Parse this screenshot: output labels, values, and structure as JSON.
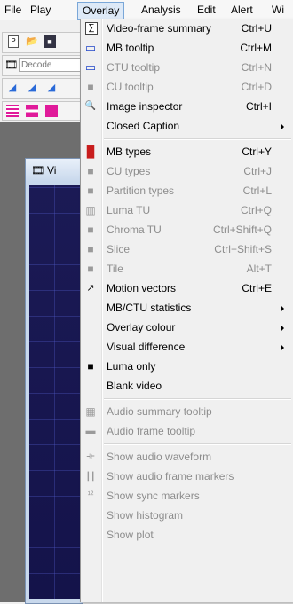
{
  "menubar": {
    "items": [
      "File",
      "Play",
      "Overlay",
      "Analysis",
      "Edit",
      "Alert",
      "Wi"
    ],
    "active": "Overlay"
  },
  "toolbar": {
    "decode_label": "Decode"
  },
  "child_window": {
    "title": "Vi"
  },
  "overlay_menu": {
    "groups": [
      [
        {
          "label": "Video-frame summary",
          "shortcut": "Ctrl+U",
          "icon": "summary-icon",
          "enabled": true
        },
        {
          "label": "MB tooltip",
          "shortcut": "Ctrl+M",
          "icon": "tooltip-icon",
          "enabled": true
        },
        {
          "label": "CTU tooltip",
          "shortcut": "Ctrl+N",
          "icon": "tooltip-icon",
          "enabled": false
        },
        {
          "label": "CU tooltip",
          "shortcut": "Ctrl+D",
          "icon": "square-icon",
          "enabled": false
        },
        {
          "label": "Image inspector",
          "shortcut": "Ctrl+I",
          "icon": "magnifier-icon",
          "enabled": true
        },
        {
          "label": "Closed Caption",
          "shortcut": "",
          "submenu": true,
          "enabled": true
        }
      ],
      [
        {
          "label": "MB types",
          "shortcut": "Ctrl+Y",
          "icon": "grid-icon",
          "enabled": true
        },
        {
          "label": "CU types",
          "shortcut": "Ctrl+J",
          "icon": "square-icon",
          "enabled": false
        },
        {
          "label": "Partition types",
          "shortcut": "Ctrl+L",
          "icon": "square-icon",
          "enabled": false
        },
        {
          "label": "Luma TU",
          "shortcut": "Ctrl+Q",
          "icon": "luma-tu-icon",
          "enabled": false
        },
        {
          "label": "Chroma TU",
          "shortcut": "Ctrl+Shift+Q",
          "icon": "square-icon",
          "enabled": false
        },
        {
          "label": "Slice",
          "shortcut": "Ctrl+Shift+S",
          "icon": "square-icon",
          "enabled": false
        },
        {
          "label": "Tile",
          "shortcut": "Alt+T",
          "icon": "square-icon",
          "enabled": false
        },
        {
          "label": "Motion vectors",
          "shortcut": "Ctrl+E",
          "icon": "arrow-icon",
          "enabled": true
        },
        {
          "label": "MB/CTU statistics",
          "shortcut": "",
          "submenu": true,
          "enabled": true
        },
        {
          "label": "Overlay colour",
          "shortcut": "",
          "submenu": true,
          "enabled": true
        },
        {
          "label": "Visual difference",
          "shortcut": "",
          "submenu": true,
          "enabled": true
        },
        {
          "label": "Luma only",
          "shortcut": "",
          "icon": "luma-only-icon",
          "enabled": true
        },
        {
          "label": "Blank video",
          "shortcut": "",
          "enabled": true
        }
      ],
      [
        {
          "label": "Audio summary tooltip",
          "shortcut": "",
          "icon": "audio-summary-icon",
          "enabled": false
        },
        {
          "label": "Audio frame tooltip",
          "shortcut": "",
          "icon": "audio-frame-icon",
          "enabled": false
        }
      ],
      [
        {
          "label": "Show audio waveform",
          "shortcut": "",
          "icon": "waveform-icon",
          "enabled": false
        },
        {
          "label": "Show audio frame markers",
          "shortcut": "",
          "icon": "frame-markers-icon",
          "enabled": false
        },
        {
          "label": "Show sync markers",
          "shortcut": "",
          "icon": "sync-markers-icon",
          "enabled": false
        },
        {
          "label": "Show histogram",
          "shortcut": "",
          "enabled": false
        },
        {
          "label": "Show plot",
          "shortcut": "",
          "enabled": false
        }
      ]
    ]
  }
}
